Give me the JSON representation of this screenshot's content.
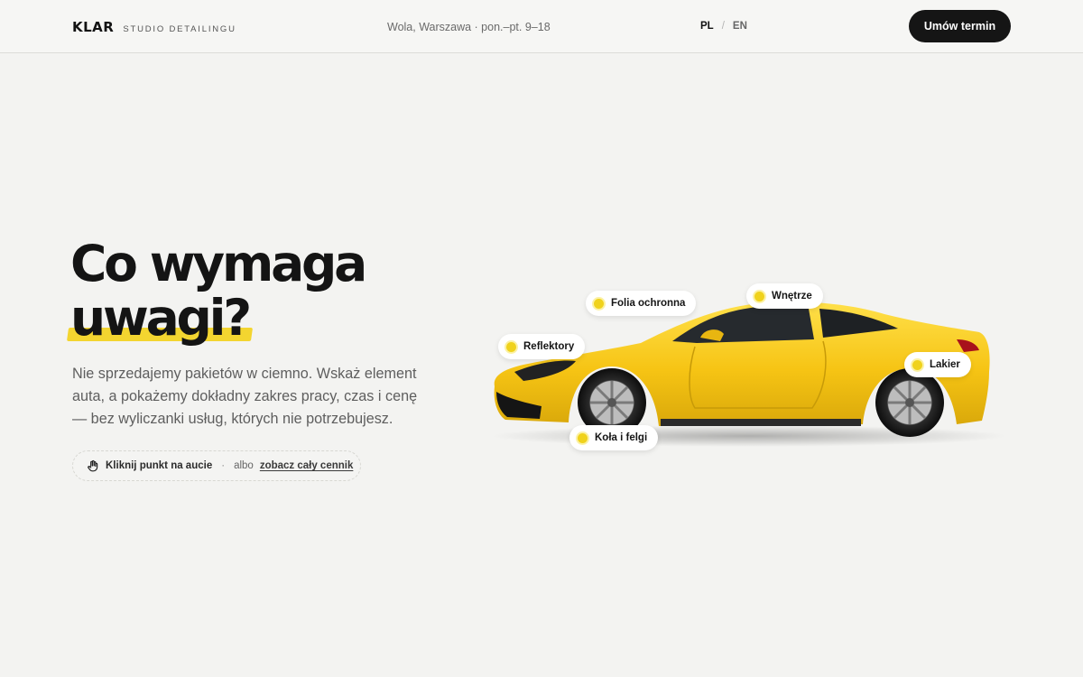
{
  "header": {
    "brand": "KLAR",
    "brand_sub": "STUDIO DETAILINGU",
    "location": "Wola, Warszawa · pon.–pt. 9–18",
    "lang_active": "PL",
    "lang_sep": "/",
    "lang_other": "EN",
    "cta_label": "Umów termin"
  },
  "hero": {
    "headline_line1": "Co wymaga",
    "headline_line2": "uwagi?",
    "lead": "Nie sprzedajemy pakietów w ciemno. Wskaż element auta, a pokażemy dokładny zakres pracy, czas i cenę — bez wyliczanki usług, których nie potrzebujesz.",
    "hint_action": "Kliknij punkt na aucie",
    "hint_dot": "·",
    "hint_or": "albo",
    "hint_link": "zobacz cały cennik"
  },
  "hotspots": [
    {
      "label": "Folia ochronna"
    },
    {
      "label": "Wnętrze"
    },
    {
      "label": "Reflektory"
    },
    {
      "label": "Lakier"
    },
    {
      "label": "Koła i felgi"
    }
  ],
  "colors": {
    "accent": "#f0d21c",
    "dark": "#151515",
    "background": "#f3f3f1",
    "car_body": "#f5c518"
  }
}
